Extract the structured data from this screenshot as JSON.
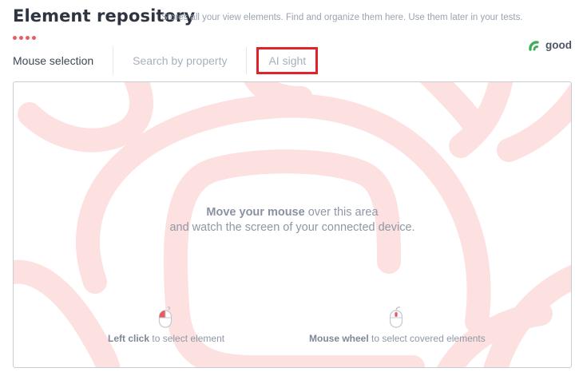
{
  "header": {
    "title": "Element repository",
    "subtitle": "Stores all your view elements. Find and organize them here. Use them later in your tests."
  },
  "connection": {
    "status": "good",
    "icon": "signal-arc-icon",
    "color": "#3fae5a"
  },
  "tabs": [
    {
      "label": "Mouse selection",
      "active": true
    },
    {
      "label": "Search by property",
      "active": false
    },
    {
      "label": "AI sight",
      "active": false,
      "highlighted": true
    }
  ],
  "stage": {
    "hint_bold": "Move your mouse",
    "hint_rest": " over this area",
    "hint_line2": "and watch the screen of your connected device.",
    "left_click_bold": "Left click",
    "left_click_rest": " to select element",
    "wheel_bold": "Mouse wheel",
    "wheel_rest": " to select covered elements"
  },
  "colors": {
    "accent": "#e85c62",
    "highlight_border": "#e0232b",
    "background_art": "#fde0e0"
  }
}
